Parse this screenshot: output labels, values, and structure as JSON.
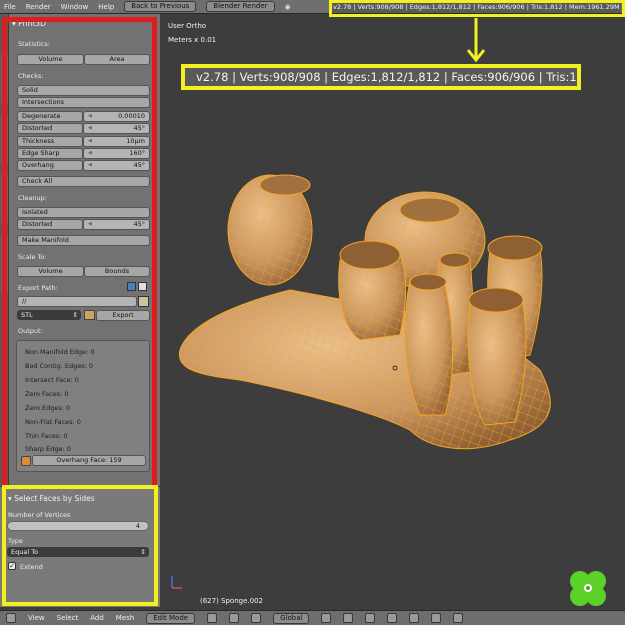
{
  "topbar": {
    "menus": [
      "File",
      "Render",
      "Window",
      "Help"
    ],
    "back_button": "Back to Previous",
    "engine": "Blender Render",
    "stats": "v2.78 | Verts:908/908 | Edges:1,812/1,812 | Faces:906/906 | Tris:1,812 | Mem:1961.29M"
  },
  "print3d": {
    "title": "Print3D",
    "statistics_label": "Statistics:",
    "volume_btn": "Volume",
    "area_btn": "Area",
    "checks_label": "Checks:",
    "solid_btn": "Solid",
    "intersections_btn": "Intersections",
    "degenerate": {
      "label": "Degenerate",
      "value": "0.00010"
    },
    "distorted": {
      "label": "Distorted",
      "value": "45°"
    },
    "thickness": {
      "label": "Thickness",
      "value": "10µm"
    },
    "edge_sharp": {
      "label": "Edge Sharp",
      "value": "160°"
    },
    "overhang": {
      "label": "Overhang",
      "value": "45°"
    },
    "check_all_btn": "Check All",
    "cleanup_label": "Cleanup:",
    "isolated_btn": "Isolated",
    "cleanup_distorted": {
      "label": "Distorted",
      "value": "45°"
    },
    "make_manifold_btn": "Make Manifold",
    "scale_to_label": "Scale To:",
    "scale_volume_btn": "Volume",
    "bounds_btn": "Bounds",
    "export_path_label": "Export Path:",
    "export_path_value": "//",
    "format": "STL",
    "export_btn": "Export",
    "output_label": "Output:",
    "output_lines": [
      "Non Manifold Edge: 0",
      "Bad Contig. Edges: 0",
      "Intersect Face: 0",
      "Zero Faces: 0",
      "Zero Edges: 0",
      "Non-Flat Faces: 0",
      "Thin Faces: 0",
      "Sharp Edge: 0"
    ],
    "overhang_face_btn": "Overhang Face: 159"
  },
  "redo_panel": {
    "title": "Select Faces by Sides",
    "num_vertices_label": "Number of Vertices",
    "num_vertices_value": "4",
    "type_label": "Type",
    "type_value": "Equal To",
    "extend_label": "Extend",
    "extend_checked": true
  },
  "viewport": {
    "view_label": "User Ortho",
    "scale_label": "Meters x 0.01",
    "stats_zoom": "v2.78 | Verts:908/908 | Edges:1,812/1,812 | Faces:906/906 | Tris:1,812 | M",
    "object_label": "(627) Sponge.002"
  },
  "bottombar": {
    "menus": [
      "View",
      "Select",
      "Add",
      "Mesh"
    ],
    "mode": "Edit Mode",
    "orientation": "Global"
  },
  "colors": {
    "highlight_red": "#e01c1c",
    "highlight_yellow": "#f2f01e",
    "mesh_fill": "#d8a56f",
    "mesh_wire": "#f5a623"
  }
}
